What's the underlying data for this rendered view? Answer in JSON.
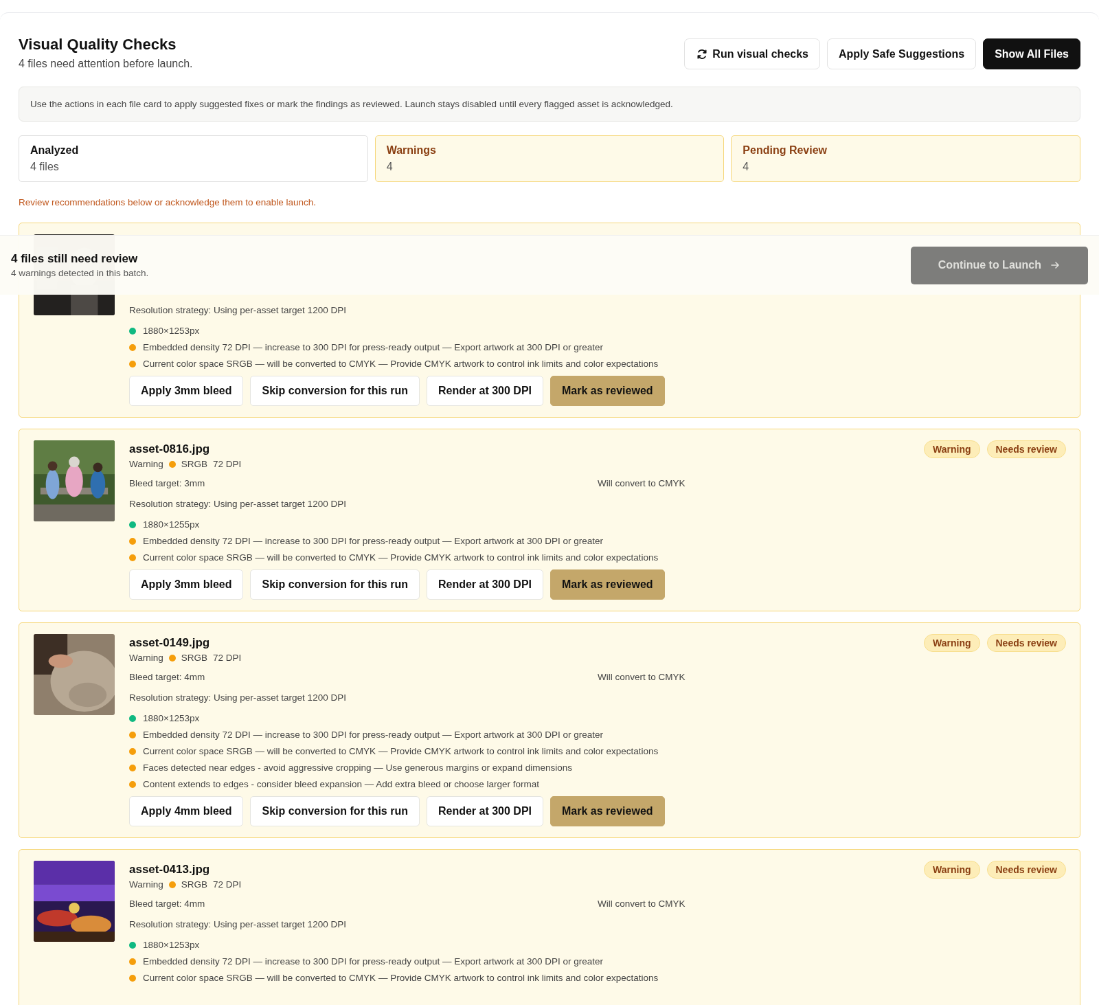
{
  "header": {
    "title": "Visual Quality Checks",
    "subtitle": "4 files need attention before launch.",
    "actions": [
      {
        "label": "Run visual checks",
        "kind": "refresh"
      },
      {
        "label": "Apply Safe Suggestions",
        "kind": "plain"
      },
      {
        "label": "Show All Files",
        "kind": "primary"
      }
    ]
  },
  "info": "Use the actions in each file card to apply suggested fixes or mark the findings as reviewed. Launch stays disabled until every flagged asset is acknowledged.",
  "stats": [
    {
      "label": "Analyzed",
      "value": "4 files",
      "kind": "neutral"
    },
    {
      "label": "Warnings",
      "value": "4",
      "kind": "warning"
    },
    {
      "label": "Pending Review",
      "value": "4",
      "kind": "warning"
    }
  ],
  "notice": "Review recommendations below or acknowledge them to enable launch.",
  "review_bar": {
    "title": "4 files still need review",
    "subtitle": "4 warnings detected in this batch.",
    "button": {
      "label": "Continue to Launch",
      "disabled": true
    }
  },
  "files": [
    {
      "thumbnail": {
        "kind": "picture"
      },
      "strategy": "Resolution strategy: Using per-asset target 1200 DPI",
      "checks": [
        {
          "text": "1880×1253px",
          "color": "#10b981"
        },
        {
          "text": "Embedded density 72 DPI — increase to 300 DPI for press-ready output — Export artwork at 300 DPI or greater",
          "color": "#f59e0b"
        },
        {
          "text": "Current color space SRGB — will be converted to CMYK — Provide CMYK artwork to control ink limits and color expectations",
          "color": "#f59e0b"
        }
      ],
      "actions": [
        {
          "label": "Apply 3mm bleed",
          "kind": "secondary"
        },
        {
          "label": "Skip conversion for this run",
          "kind": "secondary"
        },
        {
          "label": "Render at 300 DPI",
          "kind": "secondary"
        },
        {
          "label": "Mark as reviewed",
          "kind": "review"
        }
      ]
    },
    {
      "thumbnail": {
        "kind": "picture"
      },
      "name": "asset-0816.jpg",
      "status": "Warning",
      "color": "#f59e0b",
      "color_space": "SRGB",
      "dpi": "72 DPI",
      "badges": [
        "Warning",
        "Needs review"
      ],
      "bleed": "Bleed target: 3mm",
      "conversion": "Will convert to CMYK",
      "strategy": "Resolution strategy: Using per-asset target 1200 DPI",
      "checks": [
        {
          "text": "1880×1255px",
          "color": "#10b981"
        },
        {
          "text": "Embedded density 72 DPI — increase to 300 DPI for press-ready output — Export artwork at 300 DPI or greater",
          "color": "#f59e0b"
        },
        {
          "text": "Current color space SRGB — will be converted to CMYK — Provide CMYK artwork to control ink limits and color expectations",
          "color": "#f59e0b"
        }
      ],
      "actions": [
        {
          "label": "Apply 3mm bleed",
          "kind": "secondary"
        },
        {
          "label": "Skip conversion for this run",
          "kind": "secondary"
        },
        {
          "label": "Render at 300 DPI",
          "kind": "secondary"
        },
        {
          "label": "Mark as reviewed",
          "kind": "review"
        }
      ]
    },
    {
      "thumbnail": {
        "kind": "picture"
      },
      "name": "asset-0149.jpg",
      "status": "Warning",
      "color": "#f59e0b",
      "color_space": "SRGB",
      "dpi": "72 DPI",
      "badges": [
        "Warning",
        "Needs review"
      ],
      "bleed": "Bleed target: 4mm",
      "conversion": "Will convert to CMYK",
      "strategy": "Resolution strategy: Using per-asset target 1200 DPI",
      "checks": [
        {
          "text": "1880×1253px",
          "color": "#10b981"
        },
        {
          "text": "Embedded density 72 DPI — increase to 300 DPI for press-ready output — Export artwork at 300 DPI or greater",
          "color": "#f59e0b"
        },
        {
          "text": "Current color space SRGB — will be converted to CMYK — Provide CMYK artwork to control ink limits and color expectations",
          "color": "#f59e0b"
        },
        {
          "text": "Faces detected near edges - avoid aggressive cropping — Use generous margins or expand dimensions",
          "color": "#f59e0b"
        },
        {
          "text": "Content extends to edges - consider bleed expansion — Add extra bleed or choose larger format",
          "color": "#f59e0b"
        }
      ],
      "actions": [
        {
          "label": "Apply 4mm bleed",
          "kind": "secondary"
        },
        {
          "label": "Skip conversion for this run",
          "kind": "secondary"
        },
        {
          "label": "Render at 300 DPI",
          "kind": "secondary"
        },
        {
          "label": "Mark as reviewed",
          "kind": "review"
        }
      ]
    },
    {
      "thumbnail": {
        "kind": "picture"
      },
      "name": "asset-0413.jpg",
      "status": "Warning",
      "color": "#f59e0b",
      "color_space": "SRGB",
      "dpi": "72 DPI",
      "badges": [
        "Warning",
        "Needs review"
      ],
      "bleed": "Bleed target: 4mm",
      "conversion": "Will convert to CMYK",
      "strategy": "Resolution strategy: Using per-asset target 1200 DPI",
      "checks": [
        {
          "text": "1880×1253px",
          "color": "#10b981"
        },
        {
          "text": "Embedded density 72 DPI — increase to 300 DPI for press-ready output — Export artwork at 300 DPI or greater",
          "color": "#f59e0b"
        },
        {
          "text": "Current color space SRGB — will be converted to CMYK — Provide CMYK artwork to control ink limits and color expectations",
          "color": "#f59e0b"
        }
      ]
    }
  ]
}
